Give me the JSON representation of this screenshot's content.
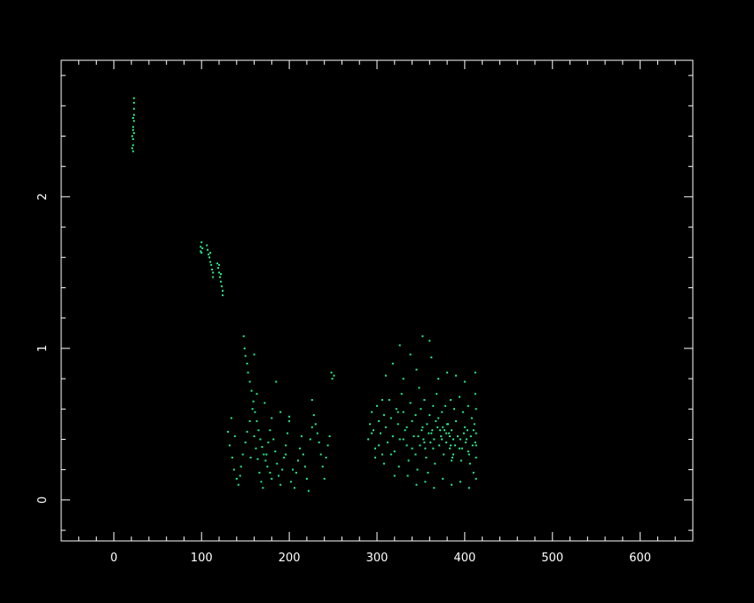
{
  "colors": {
    "background": "#000000",
    "axis": "#ffffff",
    "points": "#22ee88"
  },
  "chart_data": {
    "type": "scatter",
    "title": "",
    "xlabel": "",
    "ylabel": "",
    "xlim": [
      -60,
      660
    ],
    "ylim": [
      -0.27,
      2.9
    ],
    "grid": false,
    "legend": "none",
    "x_major_ticks": [
      0,
      100,
      200,
      300,
      400,
      500,
      600
    ],
    "x_tick_labels": [
      "0",
      "100",
      "200",
      "300",
      "400",
      "500",
      "600"
    ],
    "x_minor_step": 20,
    "y_major_ticks": [
      0,
      1,
      2
    ],
    "y_tick_labels": [
      "0",
      "1",
      "2"
    ],
    "y_minor_step": 0.2,
    "series": [
      {
        "points": [
          [
            22,
            2.3
          ],
          [
            22,
            2.34
          ],
          [
            22,
            2.38
          ],
          [
            23,
            2.42
          ],
          [
            22,
            2.46
          ],
          [
            23,
            2.5
          ],
          [
            23,
            2.54
          ],
          [
            23,
            2.58
          ],
          [
            23,
            2.62
          ],
          [
            23,
            2.65
          ],
          [
            21,
            2.32
          ],
          [
            21,
            2.4
          ],
          [
            22,
            2.44
          ],
          [
            22,
            2.52
          ],
          [
            99,
            1.64
          ],
          [
            99,
            1.67
          ],
          [
            100,
            1.7
          ],
          [
            101,
            1.66
          ],
          [
            100,
            1.63
          ],
          [
            106,
            1.68
          ],
          [
            107,
            1.65
          ],
          [
            108,
            1.62
          ],
          [
            109,
            1.6
          ],
          [
            110,
            1.57
          ],
          [
            111,
            1.55
          ],
          [
            110,
            1.63
          ],
          [
            112,
            1.52
          ],
          [
            113,
            1.5
          ],
          [
            113,
            1.47
          ],
          [
            118,
            1.56
          ],
          [
            119,
            1.53
          ],
          [
            120,
            1.5
          ],
          [
            121,
            1.47
          ],
          [
            122,
            1.44
          ],
          [
            123,
            1.41
          ],
          [
            124,
            1.38
          ],
          [
            124,
            1.35
          ],
          [
            120,
            1.55
          ],
          [
            122,
            1.49
          ],
          [
            148,
            1.08
          ],
          [
            149,
            1.0
          ],
          [
            150,
            0.95
          ],
          [
            152,
            0.9
          ],
          [
            153,
            0.84
          ],
          [
            155,
            0.78
          ],
          [
            157,
            0.72
          ],
          [
            159,
            0.65
          ],
          [
            161,
            0.58
          ],
          [
            163,
            0.52
          ],
          [
            165,
            0.46
          ],
          [
            167,
            0.4
          ],
          [
            169,
            0.35
          ],
          [
            171,
            0.3
          ],
          [
            173,
            0.26
          ],
          [
            175,
            0.22
          ],
          [
            178,
            0.18
          ],
          [
            180,
            0.14
          ],
          [
            160,
            0.96
          ],
          [
            185,
            0.78
          ],
          [
            130,
            0.45
          ],
          [
            132,
            0.36
          ],
          [
            135,
            0.28
          ],
          [
            137,
            0.2
          ],
          [
            140,
            0.14
          ],
          [
            142,
            0.1
          ],
          [
            145,
            0.22
          ],
          [
            147,
            0.3
          ],
          [
            150,
            0.38
          ],
          [
            152,
            0.45
          ],
          [
            155,
            0.52
          ],
          [
            158,
            0.6
          ],
          [
            160,
            0.42
          ],
          [
            162,
            0.34
          ],
          [
            164,
            0.27
          ],
          [
            166,
            0.18
          ],
          [
            168,
            0.12
          ],
          [
            170,
            0.08
          ],
          [
            174,
            0.3
          ],
          [
            176,
            0.38
          ],
          [
            178,
            0.46
          ],
          [
            180,
            0.54
          ],
          [
            182,
            0.4
          ],
          [
            184,
            0.32
          ],
          [
            186,
            0.24
          ],
          [
            188,
            0.16
          ],
          [
            190,
            0.1
          ],
          [
            192,
            0.2
          ],
          [
            194,
            0.28
          ],
          [
            196,
            0.36
          ],
          [
            198,
            0.44
          ],
          [
            200,
            0.52
          ],
          [
            202,
            0.12
          ],
          [
            204,
            0.2
          ],
          [
            206,
            0.08
          ],
          [
            208,
            0.18
          ],
          [
            210,
            0.26
          ],
          [
            212,
            0.34
          ],
          [
            214,
            0.42
          ],
          [
            216,
            0.3
          ],
          [
            218,
            0.22
          ],
          [
            220,
            0.14
          ],
          [
            222,
            0.06
          ],
          [
            224,
            0.4
          ],
          [
            226,
            0.48
          ],
          [
            228,
            0.56
          ],
          [
            230,
            0.5
          ],
          [
            232,
            0.44
          ],
          [
            234,
            0.38
          ],
          [
            236,
            0.3
          ],
          [
            238,
            0.22
          ],
          [
            240,
            0.14
          ],
          [
            242,
            0.28
          ],
          [
            244,
            0.36
          ],
          [
            246,
            0.42
          ],
          [
            248,
            0.84
          ],
          [
            249,
            0.8
          ],
          [
            251,
            0.82
          ],
          [
            226,
            0.66
          ],
          [
            200,
            0.55
          ],
          [
            196,
            0.3
          ],
          [
            190,
            0.58
          ],
          [
            172,
            0.64
          ],
          [
            163,
            0.7
          ],
          [
            156,
            0.28
          ],
          [
            144,
            0.16
          ],
          [
            134,
            0.54
          ],
          [
            138,
            0.42
          ],
          [
            290,
            0.4
          ],
          [
            292,
            0.5
          ],
          [
            294,
            0.58
          ],
          [
            296,
            0.46
          ],
          [
            298,
            0.34
          ],
          [
            300,
            0.62
          ],
          [
            302,
            0.52
          ],
          [
            304,
            0.44
          ],
          [
            306,
            0.3
          ],
          [
            308,
            0.56
          ],
          [
            310,
            0.48
          ],
          [
            312,
            0.38
          ],
          [
            314,
            0.66
          ],
          [
            316,
            0.54
          ],
          [
            318,
            0.42
          ],
          [
            320,
            0.32
          ],
          [
            322,
            0.6
          ],
          [
            324,
            0.5
          ],
          [
            326,
            0.4
          ],
          [
            328,
            0.7
          ],
          [
            330,
            0.58
          ],
          [
            332,
            0.46
          ],
          [
            334,
            0.36
          ],
          [
            336,
            0.26
          ],
          [
            338,
            0.64
          ],
          [
            340,
            0.52
          ],
          [
            342,
            0.42
          ],
          [
            344,
            0.3
          ],
          [
            346,
            0.2
          ],
          [
            348,
            0.74
          ],
          [
            350,
            0.6
          ],
          [
            352,
            0.48
          ],
          [
            354,
            0.38
          ],
          [
            356,
            0.28
          ],
          [
            358,
            0.18
          ],
          [
            360,
            0.56
          ],
          [
            362,
            0.44
          ],
          [
            364,
            0.34
          ],
          [
            366,
            0.24
          ],
          [
            368,
            0.7
          ],
          [
            370,
            0.54
          ],
          [
            372,
            0.46
          ],
          [
            374,
            0.4
          ],
          [
            376,
            0.3
          ],
          [
            378,
            0.62
          ],
          [
            380,
            0.5
          ],
          [
            382,
            0.44
          ],
          [
            384,
            0.36
          ],
          [
            386,
            0.28
          ],
          [
            388,
            0.6
          ],
          [
            390,
            0.52
          ],
          [
            392,
            0.42
          ],
          [
            394,
            0.34
          ],
          [
            396,
            0.26
          ],
          [
            398,
            0.58
          ],
          [
            400,
            0.48
          ],
          [
            402,
            0.4
          ],
          [
            404,
            0.32
          ],
          [
            406,
            0.24
          ],
          [
            408,
            0.54
          ],
          [
            410,
            0.46
          ],
          [
            412,
            0.38
          ],
          [
            412,
            0.7
          ],
          [
            412,
            0.84
          ],
          [
            410,
            0.18
          ],
          [
            405,
            0.08
          ],
          [
            395,
            0.12
          ],
          [
            385,
            0.1
          ],
          [
            375,
            0.14
          ],
          [
            365,
            0.08
          ],
          [
            355,
            0.12
          ],
          [
            345,
            0.1
          ],
          [
            335,
            0.16
          ],
          [
            325,
            0.22
          ],
          [
            318,
            0.9
          ],
          [
            326,
            1.02
          ],
          [
            338,
            0.96
          ],
          [
            352,
            1.08
          ],
          [
            360,
            1.05
          ],
          [
            362,
            0.94
          ],
          [
            345,
            0.86
          ],
          [
            330,
            0.8
          ],
          [
            310,
            0.82
          ],
          [
            370,
            0.8
          ],
          [
            380,
            0.84
          ],
          [
            390,
            0.82
          ],
          [
            400,
            0.78
          ],
          [
            375,
            0.48
          ],
          [
            377,
            0.46
          ],
          [
            379,
            0.44
          ],
          [
            381,
            0.5
          ],
          [
            383,
            0.42
          ],
          [
            385,
            0.46
          ],
          [
            387,
            0.4
          ],
          [
            389,
            0.36
          ],
          [
            387,
            0.3
          ],
          [
            385,
            0.26
          ],
          [
            383,
            0.34
          ],
          [
            379,
            0.38
          ],
          [
            373,
            0.42
          ],
          [
            371,
            0.36
          ],
          [
            369,
            0.48
          ],
          [
            367,
            0.52
          ],
          [
            365,
            0.4
          ],
          [
            363,
            0.46
          ],
          [
            361,
            0.38
          ],
          [
            359,
            0.44
          ],
          [
            357,
            0.5
          ],
          [
            355,
            0.34
          ],
          [
            353,
            0.4
          ],
          [
            351,
            0.46
          ],
          [
            349,
            0.36
          ],
          [
            347,
            0.42
          ],
          [
            395,
            0.4
          ],
          [
            397,
            0.34
          ],
          [
            399,
            0.44
          ],
          [
            401,
            0.38
          ],
          [
            403,
            0.46
          ],
          [
            405,
            0.3
          ],
          [
            407,
            0.42
          ],
          [
            409,
            0.36
          ],
          [
            411,
            0.5
          ],
          [
            413,
            0.28
          ],
          [
            413,
            0.6
          ],
          [
            413,
            0.44
          ],
          [
            413,
            0.14
          ],
          [
            413,
            0.36
          ],
          [
            302,
            0.36
          ],
          [
            306,
            0.66
          ],
          [
            316,
            0.3
          ],
          [
            324,
            0.58
          ],
          [
            334,
            0.48
          ],
          [
            344,
            0.56
          ],
          [
            354,
            0.66
          ],
          [
            364,
            0.62
          ],
          [
            374,
            0.58
          ],
          [
            384,
            0.66
          ],
          [
            394,
            0.68
          ],
          [
            404,
            0.62
          ],
          [
            294,
            0.44
          ],
          [
            298,
            0.28
          ],
          [
            308,
            0.24
          ],
          [
            320,
            0.16
          ],
          [
            330,
            0.4
          ],
          [
            340,
            0.34
          ]
        ]
      }
    ]
  }
}
